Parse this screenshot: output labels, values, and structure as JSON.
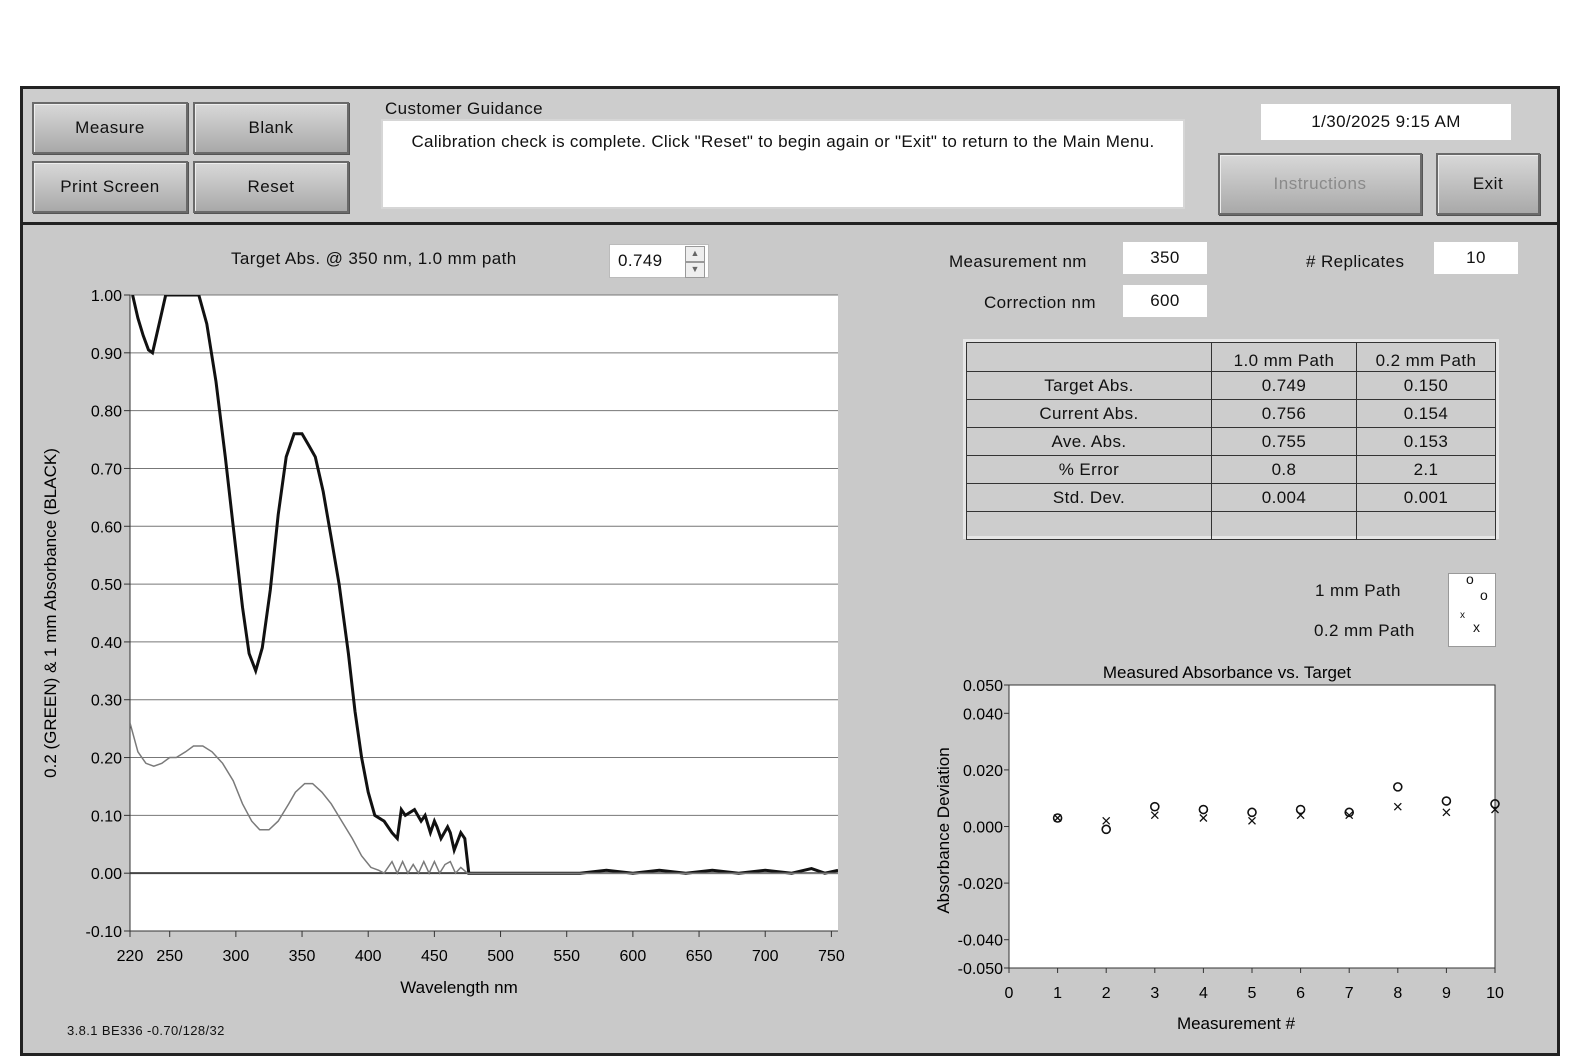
{
  "toolbar": {
    "measure_label": "Measure",
    "blank_label": "Blank",
    "print_screen_label": "Print Screen",
    "reset_label": "Reset",
    "instructions_label": "Instructions",
    "exit_label": "Exit"
  },
  "guidance": {
    "title": "Customer Guidance",
    "message": "Calibration check is complete.  Click \"Reset\" to begin again or \"Exit\" to return to the Main Menu."
  },
  "datetime": "1/30/2025  9:15 AM",
  "target": {
    "label": "Target Abs. @ 350 nm, 1.0 mm path",
    "value": "0.749"
  },
  "settings": {
    "measurement_nm_label": "Measurement nm",
    "measurement_nm_value": "350",
    "correction_nm_label": "Correction nm",
    "correction_nm_value": "600",
    "replicates_label": "# Replicates",
    "replicates_value": "10"
  },
  "results_table": {
    "headers": [
      "",
      "1.0 mm Path",
      "0.2 mm Path"
    ],
    "rows": [
      [
        "Target Abs.",
        "0.749",
        "0.150"
      ],
      [
        "Current Abs.",
        "0.756",
        "0.154"
      ],
      [
        "Ave. Abs.",
        "0.755",
        "0.153"
      ],
      [
        "% Error",
        "0.8",
        "2.1"
      ],
      [
        "Std. Dev.",
        "0.004",
        "0.001"
      ],
      [
        "",
        "",
        ""
      ]
    ]
  },
  "legend": {
    "one_mm_label": "1 mm Path",
    "two_tenths_mm_label": "0.2 mm Path",
    "one_mm_marker": "o",
    "two_tenths_mm_marker": "x"
  },
  "version": "3.8.1 BE336 -0.70/128/32",
  "colors": {
    "panel_bg": "#c9c9c9",
    "plot_bg": "#ffffff",
    "black_trace": "#111111",
    "green_trace": "#7a7a7a"
  },
  "chart_data": [
    {
      "type": "line",
      "title": "",
      "xlabel": "Wavelength nm",
      "ylabel": "0.2 (GREEN) & 1 mm Absorbance (BLACK)",
      "xlim": [
        220,
        755
      ],
      "ylim": [
        -0.1,
        1.0
      ],
      "x_ticks": [
        220,
        250,
        300,
        350,
        400,
        450,
        500,
        550,
        600,
        650,
        700,
        750
      ],
      "y_ticks": [
        "1.00",
        "0.90",
        "0.80",
        "0.70",
        "0.60",
        "0.50",
        "0.40",
        "0.30",
        "0.20",
        "0.10",
        "0.00",
        "-0.10"
      ],
      "y_tick_values": [
        1.0,
        0.9,
        0.8,
        0.7,
        0.6,
        0.5,
        0.4,
        0.3,
        0.2,
        0.1,
        0.0,
        -0.1
      ],
      "grid": "horizontal",
      "series": [
        {
          "color": "black",
          "x": [
            222,
            226,
            230,
            234,
            237,
            240,
            244,
            247,
            250,
            265,
            272,
            278,
            285,
            292,
            298,
            305,
            310,
            315,
            320,
            326,
            332,
            338,
            344,
            350,
            355,
            360,
            366,
            372,
            378,
            385,
            390,
            395,
            400,
            405,
            412,
            418,
            422,
            425,
            428,
            435,
            440,
            443,
            447,
            450,
            452,
            455,
            460,
            462,
            465,
            470,
            473,
            476,
            478,
            490,
            510,
            530,
            560,
            580,
            600,
            620,
            640,
            660,
            680,
            700,
            720,
            735,
            745,
            755
          ],
          "y": [
            1.0,
            0.96,
            0.93,
            0.905,
            0.9,
            0.93,
            0.97,
            1.0,
            1.0,
            1.0,
            1.0,
            0.95,
            0.85,
            0.72,
            0.6,
            0.46,
            0.38,
            0.35,
            0.39,
            0.49,
            0.62,
            0.72,
            0.76,
            0.76,
            0.74,
            0.72,
            0.66,
            0.58,
            0.5,
            0.38,
            0.28,
            0.2,
            0.14,
            0.1,
            0.09,
            0.07,
            0.06,
            0.11,
            0.1,
            0.11,
            0.09,
            0.1,
            0.07,
            0.09,
            0.08,
            0.06,
            0.08,
            0.07,
            0.04,
            0.07,
            0.06,
            0.0,
            0.0,
            0.0,
            0.0,
            0.0,
            0.0,
            0.005,
            0.0,
            0.005,
            0.0,
            0.005,
            0.0,
            0.005,
            0.0,
            0.008,
            0.0,
            0.005
          ]
        },
        {
          "color": "green",
          "x": [
            220,
            226,
            232,
            238,
            244,
            250,
            255,
            262,
            268,
            275,
            282,
            290,
            298,
            305,
            312,
            318,
            325,
            332,
            340,
            345,
            352,
            358,
            365,
            372,
            380,
            388,
            395,
            402,
            408,
            412,
            418,
            422,
            426,
            430,
            434,
            438,
            442,
            446,
            450,
            454,
            458,
            462,
            466,
            470,
            475,
            478,
            490,
            550,
            650,
            755
          ],
          "y": [
            0.26,
            0.21,
            0.19,
            0.185,
            0.19,
            0.2,
            0.2,
            0.21,
            0.22,
            0.22,
            0.21,
            0.19,
            0.16,
            0.12,
            0.09,
            0.075,
            0.075,
            0.09,
            0.12,
            0.14,
            0.155,
            0.155,
            0.14,
            0.12,
            0.09,
            0.06,
            0.03,
            0.01,
            0.005,
            0.0,
            0.02,
            0.0,
            0.02,
            0.0,
            0.015,
            0.0,
            0.02,
            0.0,
            0.02,
            0.0,
            0.015,
            0.02,
            0.0,
            0.01,
            0.0,
            0.0,
            0.0,
            0.0,
            0.0,
            0.0
          ]
        }
      ]
    },
    {
      "type": "scatter",
      "title": "Measured Absorbance vs. Target",
      "xlabel": "Measurement #",
      "ylabel": "Absorbance Deviation",
      "xlim": [
        0,
        10
      ],
      "ylim": [
        -0.05,
        0.05
      ],
      "x_ticks": [
        0,
        1,
        2,
        3,
        4,
        5,
        6,
        7,
        8,
        9,
        10
      ],
      "y_ticks": [
        "0.050",
        "0.040",
        "0.020",
        "0.000",
        "-0.020",
        "-0.040",
        "-0.050"
      ],
      "y_tick_values": [
        0.05,
        0.04,
        0.02,
        0.0,
        -0.02,
        -0.04,
        -0.05
      ],
      "grid": false,
      "series": [
        {
          "name": "1 mm Path",
          "marker": "o",
          "x": [
            1,
            2,
            3,
            4,
            5,
            6,
            7,
            8,
            9,
            10
          ],
          "y": [
            0.003,
            -0.001,
            0.007,
            0.006,
            0.005,
            0.006,
            0.005,
            0.014,
            0.009,
            0.008
          ]
        },
        {
          "name": "0.2 mm Path",
          "marker": "x",
          "x": [
            1,
            2,
            3,
            4,
            5,
            6,
            7,
            8,
            9,
            10
          ],
          "y": [
            0.003,
            0.002,
            0.004,
            0.003,
            0.002,
            0.004,
            0.004,
            0.007,
            0.005,
            0.006
          ]
        }
      ]
    }
  ]
}
